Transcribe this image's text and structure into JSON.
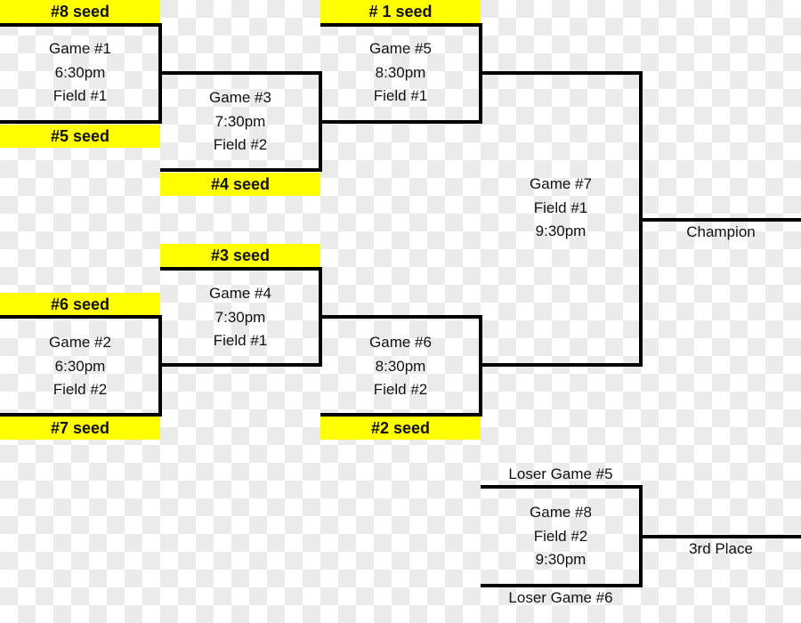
{
  "seeds": {
    "s8": "#8 seed",
    "s5": "#5 seed",
    "s4": "#4 seed",
    "s1": "# 1 seed",
    "s3": "#3 seed",
    "s6": "#6 seed",
    "s7": "#7 seed",
    "s2": "#2 seed"
  },
  "games": {
    "g1": [
      "Game #1",
      "6:30pm",
      "Field #1"
    ],
    "g2": [
      "Game #2",
      "6:30pm",
      "Field #2"
    ],
    "g3": [
      "Game #3",
      "7:30pm",
      "Field #2"
    ],
    "g4": [
      "Game #4",
      "7:30pm",
      "Field #1"
    ],
    "g5": [
      "Game #5",
      "8:30pm",
      "Field #1"
    ],
    "g6": [
      "Game #6",
      "8:30pm",
      "Field #2"
    ],
    "g7": [
      "Game #7",
      "Field #1",
      "9:30pm"
    ],
    "g8": [
      "Game #8",
      "Field #2",
      "9:30pm"
    ]
  },
  "labels": {
    "champion": "Champion",
    "third_place": "3rd Place",
    "loser5": "Loser Game #5",
    "loser6": "Loser Game #6"
  },
  "colors": {
    "seed_highlight": "#ffff00",
    "lines": "#000000"
  }
}
